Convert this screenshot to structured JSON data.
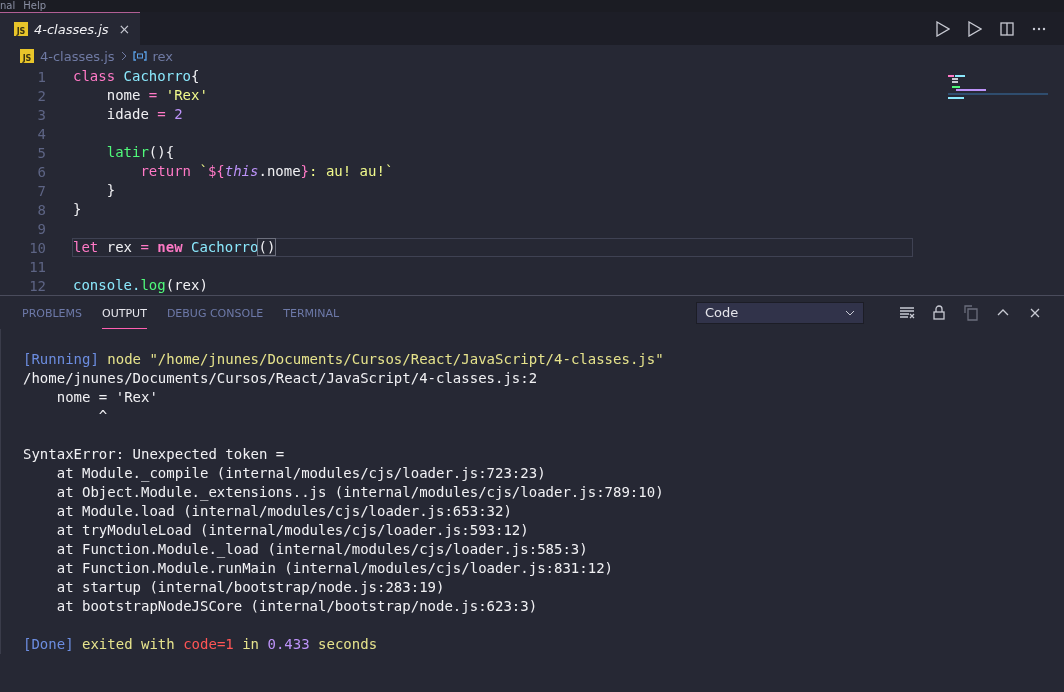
{
  "menu": [
    "nal",
    "Help"
  ],
  "tabs": [
    {
      "label": "4-classes.js",
      "badge": "JS",
      "close": "×",
      "selected": true
    }
  ],
  "breadcrumb": {
    "badge": "JS",
    "file": "4-classes.js",
    "symbol": "rex"
  },
  "code": [
    {
      "number": "1",
      "current": false,
      "tokens": [
        {
          "text": "class ",
          "kind": "keyword"
        },
        {
          "text": "Cachorro",
          "kind": "class"
        },
        {
          "text": "{",
          "kind": "plain"
        }
      ]
    },
    {
      "number": "2",
      "current": false,
      "tokens": [
        {
          "text": "    nome ",
          "kind": "plain"
        },
        {
          "text": "= ",
          "kind": "keyword"
        },
        {
          "text": "'Rex'",
          "kind": "string"
        }
      ]
    },
    {
      "number": "3",
      "current": false,
      "tokens": [
        {
          "text": "    idade ",
          "kind": "plain"
        },
        {
          "text": "= ",
          "kind": "keyword"
        },
        {
          "text": "2",
          "kind": "number"
        }
      ]
    },
    {
      "number": "4",
      "current": false
    },
    {
      "number": "5",
      "current": false,
      "tokens": [
        {
          "text": "    latir",
          "kind": "func"
        },
        {
          "text": "(){",
          "kind": "plain"
        }
      ]
    },
    {
      "number": "6",
      "current": false,
      "tokens": [
        {
          "text": "        return ",
          "kind": "keyword"
        },
        {
          "text": "`",
          "kind": "string"
        },
        {
          "text": "${",
          "kind": "keyword"
        },
        {
          "text": "this",
          "kind": "this"
        },
        {
          "text": ".nome",
          "kind": "plain"
        },
        {
          "text": "}",
          "kind": "keyword"
        },
        {
          "text": ": au! au!`",
          "kind": "string"
        }
      ]
    },
    {
      "number": "7",
      "current": false,
      "tokens": [
        {
          "text": "    }",
          "kind": "plain"
        }
      ]
    },
    {
      "number": "8",
      "current": false,
      "tokens": [
        {
          "text": "}",
          "kind": "plain"
        }
      ]
    },
    {
      "number": "9",
      "current": false
    },
    {
      "number": "10",
      "current": true,
      "tokens": [
        {
          "text": "let ",
          "kind": "keyword"
        },
        {
          "text": "rex ",
          "kind": "plain"
        },
        {
          "text": "= ",
          "kind": "keyword"
        },
        {
          "text": "new ",
          "kind": "bold"
        },
        {
          "text": "Cachorro",
          "kind": "class"
        },
        {
          "text": "()",
          "kind": "match"
        }
      ]
    },
    {
      "number": "11",
      "current": false
    },
    {
      "number": "12",
      "current": false,
      "tokens": [
        {
          "text": "console.",
          "kind": "class"
        },
        {
          "text": "log",
          "kind": "func"
        },
        {
          "text": "(rex)",
          "kind": "plain"
        }
      ]
    }
  ],
  "panel_tabs": [
    {
      "label": "PROBLEMS",
      "selected": false
    },
    {
      "label": "OUTPUT",
      "selected": true
    },
    {
      "label": "DEBUG CONSOLE",
      "selected": false
    },
    {
      "label": "TERMINAL",
      "selected": false
    }
  ],
  "output_channel": "Code",
  "output": [
    {
      "tokens": [
        {
          "text": "[Running] ",
          "kind": "tag"
        },
        {
          "text": "node \"/home/jnunes/Documents/Cursos/React/JavaScript/4-classes.js\"",
          "kind": "yellow"
        }
      ]
    },
    {
      "tokens": [
        {
          "text": "/home/jnunes/Documents/Cursos/React/JavaScript/4-classes.js:2",
          "kind": "plain"
        }
      ]
    },
    {
      "tokens": [
        {
          "text": "    nome = 'Rex'",
          "kind": "plain"
        }
      ]
    },
    {
      "tokens": [
        {
          "text": "         ^",
          "kind": "plain"
        }
      ]
    },
    {
      "gap_before": true,
      "tokens": [
        {
          "text": "SyntaxError: Unexpected token =",
          "kind": "plain"
        }
      ]
    },
    {
      "tokens": [
        {
          "text": "    at Module._compile (internal/modules/cjs/loader.js:723:23)",
          "kind": "plain"
        }
      ]
    },
    {
      "tokens": [
        {
          "text": "    at Object.Module._extensions..js (internal/modules/cjs/loader.js:789:10)",
          "kind": "plain"
        }
      ]
    },
    {
      "tokens": [
        {
          "text": "    at Module.load (internal/modules/cjs/loader.js:653:32)",
          "kind": "plain"
        }
      ]
    },
    {
      "tokens": [
        {
          "text": "    at tryModuleLoad (internal/modules/cjs/loader.js:593:12)",
          "kind": "plain"
        }
      ]
    },
    {
      "tokens": [
        {
          "text": "    at Function.Module._load (internal/modules/cjs/loader.js:585:3)",
          "kind": "plain"
        }
      ]
    },
    {
      "tokens": [
        {
          "text": "    at Function.Module.runMain (internal/modules/cjs/loader.js:831:12)",
          "kind": "plain"
        }
      ]
    },
    {
      "tokens": [
        {
          "text": "    at startup (internal/bootstrap/node.js:283:19)",
          "kind": "plain"
        }
      ]
    },
    {
      "tokens": [
        {
          "text": "    at bootstrapNodeJSCore (internal/bootstrap/node.js:623:3)",
          "kind": "plain"
        }
      ]
    },
    {
      "gap_before": true,
      "tokens": [
        {
          "text": "[Done] ",
          "kind": "tag"
        },
        {
          "text": "exited with ",
          "kind": "yellow"
        },
        {
          "text": "code=1",
          "kind": "red"
        },
        {
          "text": " in ",
          "kind": "yellow"
        },
        {
          "text": "0.433",
          "kind": "number"
        },
        {
          "text": " seconds",
          "kind": "yellow"
        }
      ]
    }
  ]
}
